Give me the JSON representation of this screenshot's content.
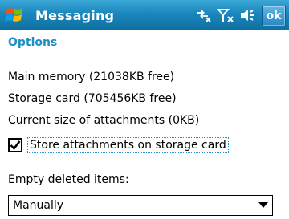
{
  "titlebar": {
    "app_title": "Messaging",
    "ok_label": "ok",
    "accent": "#1a86bd"
  },
  "section": {
    "title": "Options"
  },
  "info": {
    "main_memory": "Main memory (21038KB free)",
    "storage_card": "Storage card (705456KB free)",
    "attachments_size": "Current size of attachments (0KB)"
  },
  "store_attachments": {
    "label": "Store attachments on storage card",
    "checked": true
  },
  "empty_deleted": {
    "label": "Empty deleted items:",
    "selected": "Manually"
  }
}
